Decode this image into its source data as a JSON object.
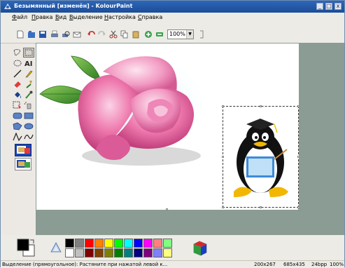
{
  "window": {
    "title": "Безымянный [изменён] - KolourPaint",
    "minimize": "_",
    "maximize": "□",
    "close": "x"
  },
  "menu": [
    {
      "u": "Ф",
      "rest": "айл"
    },
    {
      "u": "П",
      "rest": "равка"
    },
    {
      "u": "В",
      "rest": "ид"
    },
    {
      "u": "В",
      "rest": "ыделение"
    },
    {
      "u": "Н",
      "rest": "астройка"
    },
    {
      "u": "С",
      "rest": "правка"
    }
  ],
  "toolbar": {
    "zoom_value": "100%"
  },
  "colors": {
    "title_bg": "#2e66b9",
    "canvas_bg": "#ffffff",
    "workspace_bg": "#8a9c93",
    "palette_top": [
      "#000000",
      "#808080",
      "#ff0000",
      "#ff8000",
      "#ffff00",
      "#00ff00",
      "#00ffff",
      "#0000ff",
      "#ff00ff",
      "#ff8080",
      "#80ff80"
    ],
    "palette_bottom": [
      "#ffffff",
      "#c0c0c0",
      "#800000",
      "#804000",
      "#808000",
      "#008000",
      "#008080",
      "#000080",
      "#800080",
      "#8080ff",
      "#ffff80"
    ]
  },
  "status": {
    "message": "Выделение (прямоугольное): Растяните при нажатой левой к...",
    "selection_size": "200x267",
    "image_size": "685x435",
    "bpp": "24bpp",
    "zoom": "100%"
  }
}
